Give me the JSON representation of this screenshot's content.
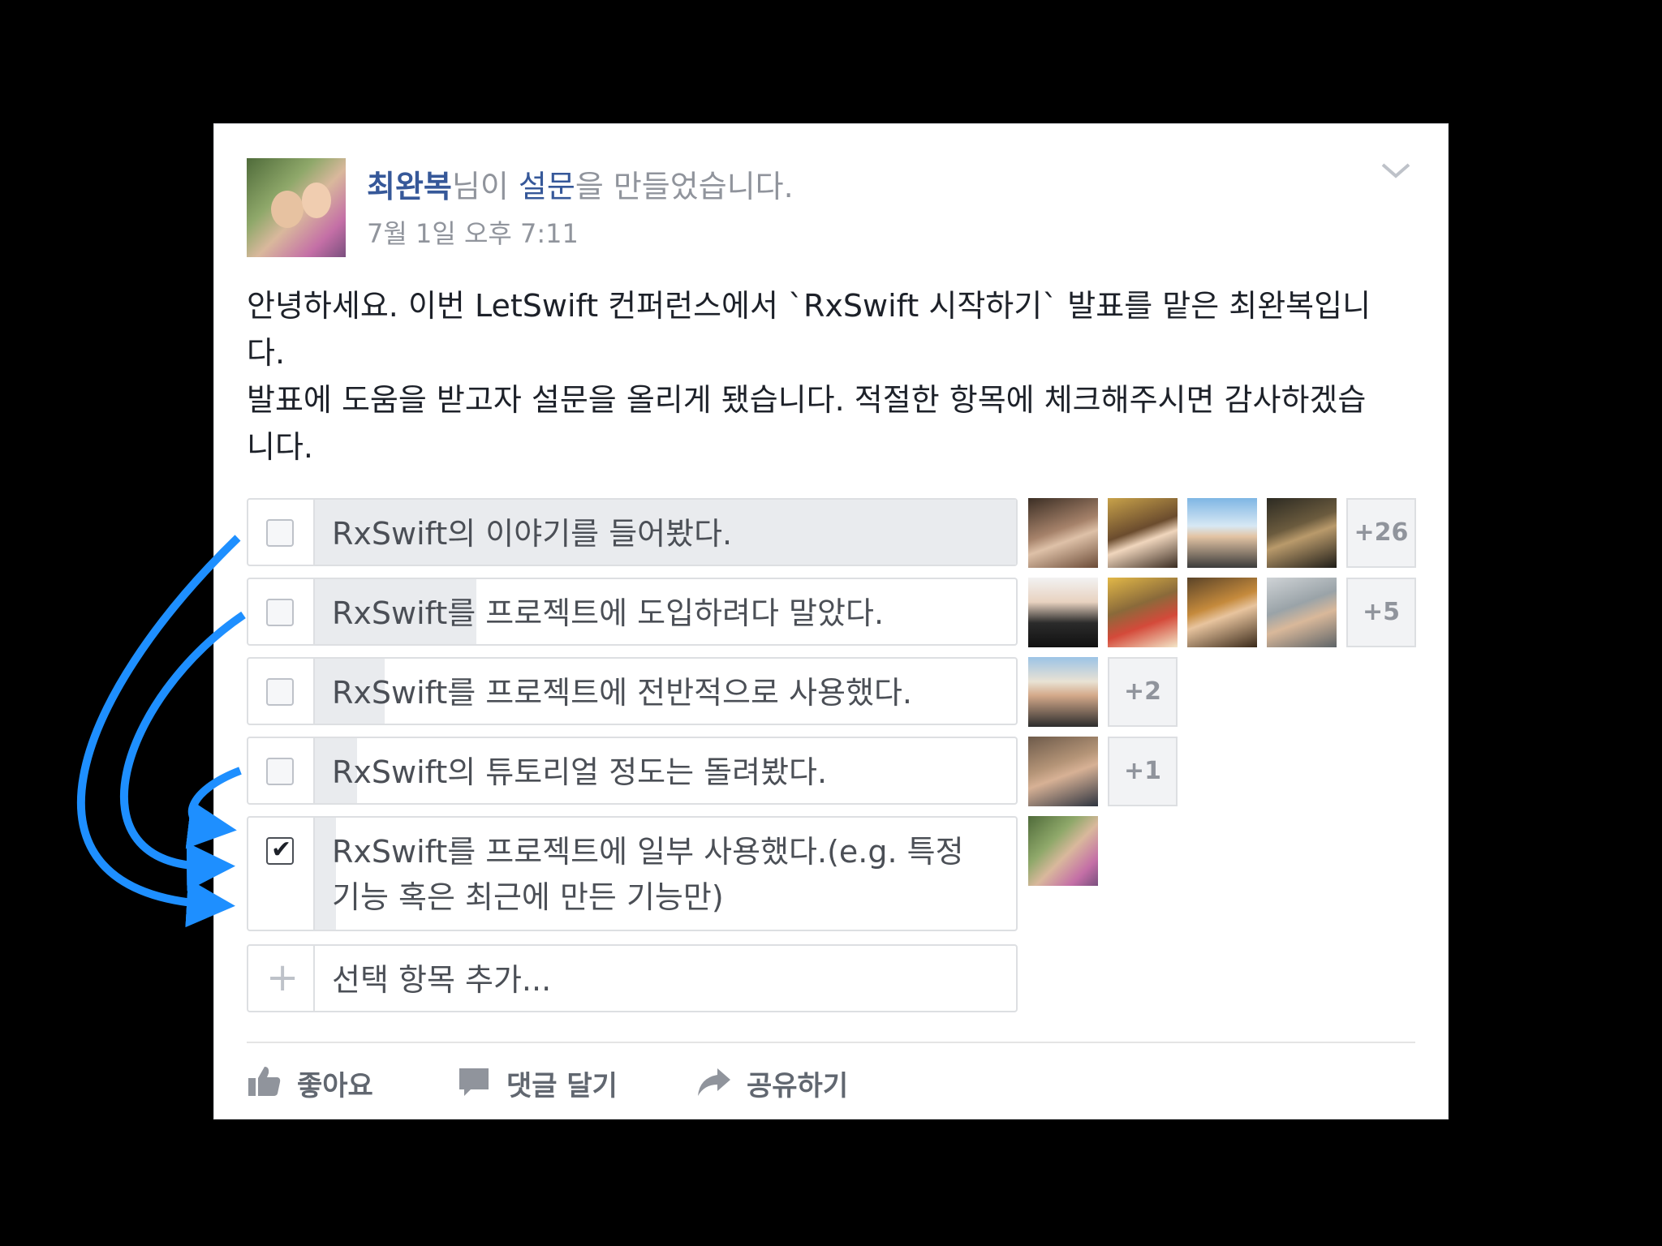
{
  "post": {
    "author": "최완복",
    "header_mid": "님이 ",
    "header_link": "설문",
    "header_end": "을 만들었습니다.",
    "timestamp": "7월 1일 오후 7:11",
    "body_lines": [
      "안녕하세요. 이번 LetSwift 컨퍼런스에서 `RxSwift 시작하기` 발표를 맡은 최완복입니",
      "다.",
      "발표에 도움을 받고자 설문을 올리게 됐습니다. 적절한 항목에 체크해주시면 감사하겠습",
      "니다."
    ]
  },
  "poll": {
    "options": [
      {
        "label": "RxSwift의 이야기를 들어봤다.",
        "checked": false,
        "more": "+26",
        "vote_share": 1.0
      },
      {
        "label": "RxSwift를 프로젝트에 도입하려다 말았다.",
        "checked": false,
        "more": "+5",
        "vote_share": 0.23
      },
      {
        "label": "RxSwift를 프로젝트에 전반적으로 사용했다.",
        "checked": false,
        "more": "+2",
        "vote_share": 0.1
      },
      {
        "label": "RxSwift의 튜토리얼 정도는 돌려봤다.",
        "checked": false,
        "more": "+1",
        "vote_share": 0.06
      },
      {
        "label_line1": "RxSwift를 프로젝트에 일부 사용했다.(e.g. 특정",
        "label_line2": "기능 혹은 최근에 만든 기능만)",
        "checked": true,
        "vote_share": 0.03
      }
    ],
    "add_option_placeholder": "선택 항목 추가..."
  },
  "actions": {
    "like": "좋아요",
    "comment": "댓글 달기",
    "share": "공유하기"
  },
  "colors": {
    "link": "#365899",
    "arrow": "#1e8fff",
    "meta": "#90949c",
    "border": "#dddfe2"
  },
  "icons": [
    "chevron-down-icon",
    "like-icon",
    "comment-icon",
    "share-icon",
    "add-icon"
  ]
}
